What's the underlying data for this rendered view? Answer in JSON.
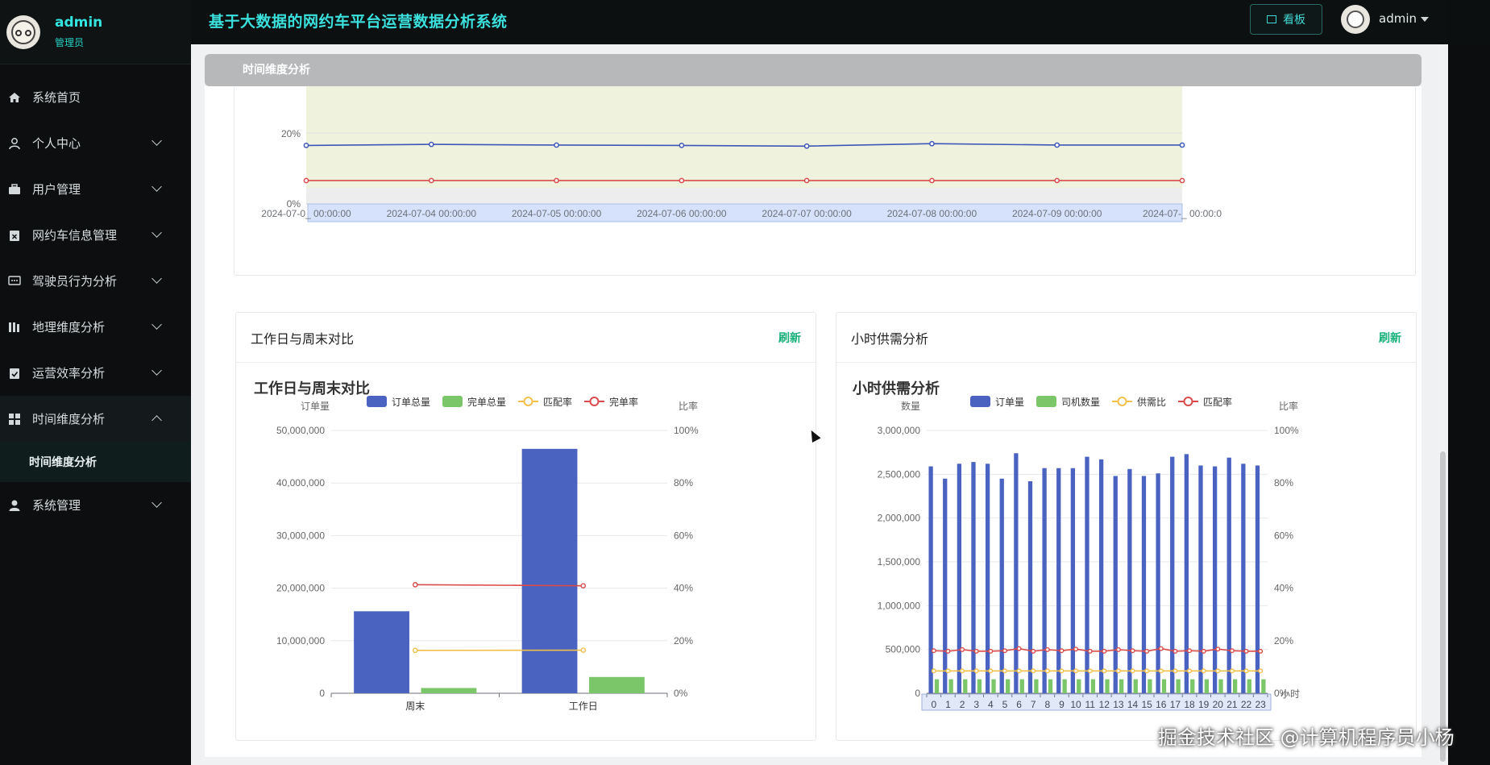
{
  "sidebar": {
    "user": "admin",
    "role": "管理员",
    "items": [
      {
        "label": "系统首页",
        "icon": "home-icon",
        "expandable": false
      },
      {
        "label": "个人中心",
        "icon": "person-icon",
        "expandable": true
      },
      {
        "label": "用户管理",
        "icon": "briefcase-icon",
        "expandable": true
      },
      {
        "label": "网约车信息管理",
        "icon": "clipboard-x-icon",
        "expandable": true
      },
      {
        "label": "驾驶员行为分析",
        "icon": "message-icon",
        "expandable": true
      },
      {
        "label": "地理维度分析",
        "icon": "bars-icon",
        "expandable": true
      },
      {
        "label": "运营效率分析",
        "icon": "clipboard-check-icon",
        "expandable": true
      },
      {
        "label": "时间维度分析",
        "icon": "grid-icon",
        "expandable": true,
        "open": true
      },
      {
        "label": "系统管理",
        "icon": "user-icon",
        "expandable": true
      }
    ],
    "submenu_active": "时间维度分析"
  },
  "header": {
    "title": "基于大数据的网约车平台运营数据分析系统",
    "board_label": "看板",
    "user": "admin"
  },
  "breadcrumb": "时间维度分析",
  "top_chart": {
    "y_ticks": [
      "0%",
      "20%"
    ],
    "x_labels": [
      "2024-07-0_ 00:00:00",
      "2024-07-04 00:00:00",
      "2024-07-05 00:00:00",
      "2024-07-06 00:00:00",
      "2024-07-07 00:00:00",
      "2024-07-08 00:00:00",
      "2024-07-09 00:00:00",
      "2024-07-_ 00:00:0"
    ]
  },
  "left_card": {
    "header": "工作日与周末对比",
    "refresh": "刷新"
  },
  "right_card": {
    "header": "小时供需分析",
    "refresh": "刷新"
  },
  "watermark": "掘金技术社区 @计算机程序员小杨",
  "colors": {
    "accent": "#33e5e0",
    "refresh": "#17b07a",
    "bar_blue": "#4a62c0",
    "bar_green": "#7cc66a",
    "line_yellow": "#f2c04a",
    "line_red": "#d94a4a"
  },
  "chart_data": [
    {
      "type": "line",
      "x": [
        "2024-07-03",
        "2024-07-04",
        "2024-07-05",
        "2024-07-06",
        "2024-07-07",
        "2024-07-08",
        "2024-07-09",
        "2024-07-10"
      ],
      "series": [
        {
          "values": [
            16.5,
            16.8,
            16.6,
            16.5,
            16.3,
            17.0,
            16.6,
            16.6
          ]
        },
        {
          "values": [
            6.6,
            6.6,
            6.6,
            6.6,
            6.6,
            6.6,
            6.6,
            6.6
          ]
        }
      ],
      "ylim": [
        0,
        40
      ]
    },
    {
      "type": "bar",
      "title": "工作日与周末对比",
      "categories": [
        "周末",
        "工作日"
      ],
      "series": [
        {
          "name": "订单总量",
          "type": "bar",
          "axis": "left",
          "values": [
            15600000,
            46500000
          ]
        },
        {
          "name": "完单总量",
          "type": "bar",
          "axis": "left",
          "values": [
            1000000,
            3100000
          ]
        },
        {
          "name": "匹配率",
          "type": "line",
          "axis": "right",
          "values": [
            16.3,
            16.4
          ]
        },
        {
          "name": "完单率",
          "type": "line",
          "axis": "right",
          "values": [
            41.3,
            40.9
          ]
        }
      ],
      "ylabel": "订单量",
      "y2label": "比率",
      "ylim": [
        0,
        50000000
      ],
      "y2lim": [
        0,
        100
      ],
      "y_ticks": [
        "0",
        "10,000,000",
        "20,000,000",
        "30,000,000",
        "40,000,000",
        "50,000,000"
      ],
      "y2_ticks": [
        "0%",
        "20%",
        "40%",
        "60%",
        "80%",
        "100%"
      ]
    },
    {
      "type": "bar",
      "title": "小时供需分析",
      "categories": [
        "0",
        "1",
        "2",
        "3",
        "4",
        "5",
        "6",
        "7",
        "8",
        "9",
        "10",
        "11",
        "12",
        "13",
        "14",
        "15",
        "16",
        "17",
        "18",
        "19",
        "20",
        "21",
        "22",
        "23"
      ],
      "series": [
        {
          "name": "订单量",
          "type": "bar",
          "axis": "left",
          "values": [
            2590000,
            2450000,
            2620000,
            2640000,
            2620000,
            2450000,
            2740000,
            2420000,
            2570000,
            2570000,
            2570000,
            2700000,
            2670000,
            2480000,
            2560000,
            2480000,
            2510000,
            2700000,
            2730000,
            2600000,
            2590000,
            2690000,
            2620000,
            2600000
          ]
        },
        {
          "name": "司机数量",
          "type": "bar",
          "axis": "left",
          "values": [
            160000,
            160000,
            160000,
            160000,
            160000,
            160000,
            160000,
            160000,
            160000,
            160000,
            160000,
            160000,
            160000,
            160000,
            160000,
            160000,
            160000,
            160000,
            160000,
            160000,
            160000,
            160000,
            160000,
            160000
          ]
        },
        {
          "name": "供需比",
          "type": "line",
          "axis": "right",
          "values": [
            8.5,
            8.5,
            8.5,
            8.5,
            8.5,
            8.5,
            8.5,
            8.5,
            8.5,
            8.5,
            8.5,
            8.5,
            8.5,
            8.5,
            8.5,
            8.5,
            8.5,
            8.5,
            8.5,
            8.5,
            8.5,
            8.5,
            8.5,
            8.5
          ]
        },
        {
          "name": "匹配率",
          "type": "line",
          "axis": "right",
          "values": [
            16.2,
            16.0,
            16.6,
            16.0,
            16.0,
            16.2,
            17.0,
            16.0,
            16.6,
            16.2,
            16.8,
            16.0,
            16.0,
            16.6,
            16.2,
            16.0,
            17.0,
            16.0,
            16.2,
            16.0,
            16.8,
            16.2,
            16.0,
            16.0
          ]
        }
      ],
      "ylabel": "数量",
      "y2label": "比率",
      "xlabel": "小时",
      "ylim": [
        0,
        3000000
      ],
      "y2lim": [
        0,
        100
      ],
      "y_ticks": [
        "0",
        "500,000",
        "1,000,000",
        "1,500,000",
        "2,000,000",
        "2,500,000",
        "3,000,000"
      ],
      "y2_ticks": [
        "0%",
        "20%",
        "40%",
        "60%",
        "80%",
        "100%"
      ]
    }
  ]
}
